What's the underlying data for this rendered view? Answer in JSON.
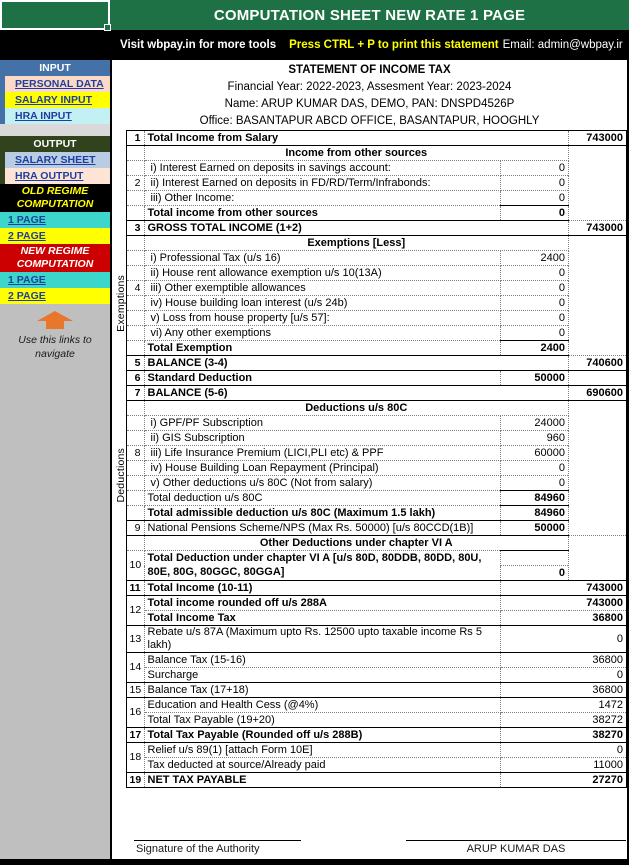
{
  "window": {
    "selected_cell_color": "#1e7145",
    "doc_title": "COMPUTATION SHEET NEW RATE 1 PAGE"
  },
  "promo_band": {
    "visit": "Visit wbpay.in for more tools",
    "print_hint": "Press CTRL + P to print this statement",
    "email": "Email: admin@wbpay.ir",
    "highlight_color": "#ffff00"
  },
  "sidebar": {
    "input_header": "INPUT",
    "input_items": [
      {
        "label": "PERSONAL DATA",
        "bg": "#fbd9c6"
      },
      {
        "label": "SALARY INPUT",
        "bg": "#ffff00"
      },
      {
        "label": "HRA INPUT",
        "bg": "#c3f0f2"
      }
    ],
    "output_header": "OUTPUT",
    "output_items": [
      {
        "label": "SALARY SHEET",
        "bg": "#b8cce4"
      },
      {
        "label": "HRA OUTPUT",
        "bg": "#fde4d4"
      }
    ],
    "old_regime_line1": "OLD REGIME",
    "old_regime_line2": "COMPUTATION",
    "old_pages": [
      {
        "label": "1 PAGE",
        "bg": "#3cd6cb"
      },
      {
        "label": "2 PAGE",
        "bg": "#ffff00"
      }
    ],
    "new_regime_line1": "NEW REGIME",
    "new_regime_line2": "COMPUTATION",
    "new_pages": [
      {
        "label": "1 PAGE",
        "bg": "#3cd6cb"
      },
      {
        "label": "2 PAGE",
        "bg": "#ffff00"
      }
    ],
    "nav_hint_line1": "Use this links to",
    "nav_hint_line2": "navigate",
    "arrow_color": "#e8762c"
  },
  "statement": {
    "title": "STATEMENT OF INCOME TAX",
    "year_line": "Financial Year: 2022-2023,  Assesment Year: 2023-2024",
    "name_line": "Name: ARUP KUMAR DAS, DEMO,   PAN: DNSPD4526P",
    "office_line": "Office: BASANTAPUR ABCD OFFICE, BASANTAPUR, HOOGHLY"
  },
  "side_labels": {
    "exemptions": "Exemptions",
    "deductions": "Deductions"
  },
  "rows": {
    "r1_num": "1",
    "r1_label": "Total Income from Salary",
    "r1_val": "743000",
    "other_src_header": "Income from other sources",
    "r2_num": "2",
    "r2_i": "i) Interest Earned on deposits in savings account:",
    "r2_i_val": "0",
    "r2_ii": "ii) Interest Earned on deposits in FD/RD/Term/Infrabonds:",
    "r2_ii_val": "0",
    "r2_iii": "iii) Other Income:",
    "r2_iii_val": "0",
    "r2_total": "Total income from other sources",
    "r2_total_val": "0",
    "r3_num": "3",
    "r3_label": "GROSS TOTAL INCOME (1+2)",
    "r3_val": "743000",
    "exempt_header": "Exemptions [Less]",
    "r4_num": "4",
    "r4_i": "i) Professional Tax (u/s 16)",
    "r4_i_val": "2400",
    "r4_ii": "ii) House rent allowance exemption u/s 10(13A)",
    "r4_ii_val": "0",
    "r4_iii": "iii) Other exemptible allowances",
    "r4_iii_val": "0",
    "r4_iv": "iv) House building loan interest (u/s 24b)",
    "r4_iv_val": "0",
    "r4_v": "v) Loss from house property [u/s 57]:",
    "r4_v_val": "0",
    "r4_vi": "vi) Any other exemptions",
    "r4_vi_val": "0",
    "r4_total": "Total Exemption",
    "r4_total_val": "2400",
    "r5_num": "5",
    "r5_label": "BALANCE (3-4)",
    "r5_val": "740600",
    "r6_num": "6",
    "r6_label": "Standard Deduction",
    "r6_mid": "50000",
    "r7_num": "7",
    "r7_label": "BALANCE (5-6)",
    "r7_val": "690600",
    "ded80c_header": "Deductions u/s 80C",
    "r8_num": "8",
    "r8_i": "i) GPF/PF Subscription",
    "r8_i_val": "24000",
    "r8_ii": "ii) GIS Subscription",
    "r8_ii_val": "960",
    "r8_iii": "iii) Life Insurance Premium (LICI,PLI etc) & PPF",
    "r8_iii_val": "60000",
    "r8_iv": "iv) House Building Loan Repayment (Principal)",
    "r8_iv_val": "0",
    "r8_v": "v) Other deductions u/s 80C (Not from salary)",
    "r8_v_val": "0",
    "r8_total": "Total deduction u/s 80C",
    "r8_total_val": "84960",
    "r8_admiss": "Total admissible deduction u/s 80C (Maximum 1.5 lakh)",
    "r8_admiss_val": "84960",
    "r9_num": "9",
    "r9_label": "National Pensions Scheme/NPS (Max Rs. 50000) [u/s 80CCD(1B)]",
    "r9_mid": "50000",
    "other_ded_header": "Other Deductions under chapter VI A",
    "r10_num": "10",
    "r10_label_l1": "Total Deduction under chapter VI A [u/s 80D, 80DDB, 80DD, 80U,",
    "r10_label_l2": "80E, 80G, 80GGC, 80GGA]",
    "r10_mid": "0",
    "r11_num": "11",
    "r11_label": "Total Income (10-11)",
    "r11_val": "743000",
    "r12_num": "12",
    "r12_a_label": "Total income rounded off u/s 288A",
    "r12_a_val": "743000",
    "r12_b_label": "Total Income Tax",
    "r12_b_val": "36800",
    "r13_num": "13",
    "r13_label": "Rebate u/s 87A (Maximum upto Rs. 12500 upto taxable income Rs 5 lakh)",
    "r13_val": "0",
    "r14_num": "14",
    "r14_a_label": "Balance Tax (15-16)",
    "r14_a_val": "36800",
    "r14_b_label": "Surcharge",
    "r14_b_val": "0",
    "r15_num": "15",
    "r15_label": "Balance Tax (17+18)",
    "r15_val": "36800",
    "r16_num": "16",
    "r16_a_label": "Education and Health Cess (@4%)",
    "r16_a_val": "1472",
    "r16_b_label": "Total Tax Payable (19+20)",
    "r16_b_val": "38272",
    "r17_num": "17",
    "r17_label": "Total Tax Payable (Rounded off u/s 288B)",
    "r17_val": "38270",
    "r18_num": "18",
    "r18_a_label": "Relief u/s 89(1) [attach Form 10E]",
    "r18_a_val": "0",
    "r18_b_label": "Tax deducted at source/Already paid",
    "r18_b_val": "11000",
    "r19_num": "19",
    "r19_label": "NET TAX PAYABLE",
    "r19_val": "27270"
  },
  "footer": {
    "signature_authority": "Signature of the Authority",
    "signature_name": "ARUP KUMAR DAS"
  }
}
